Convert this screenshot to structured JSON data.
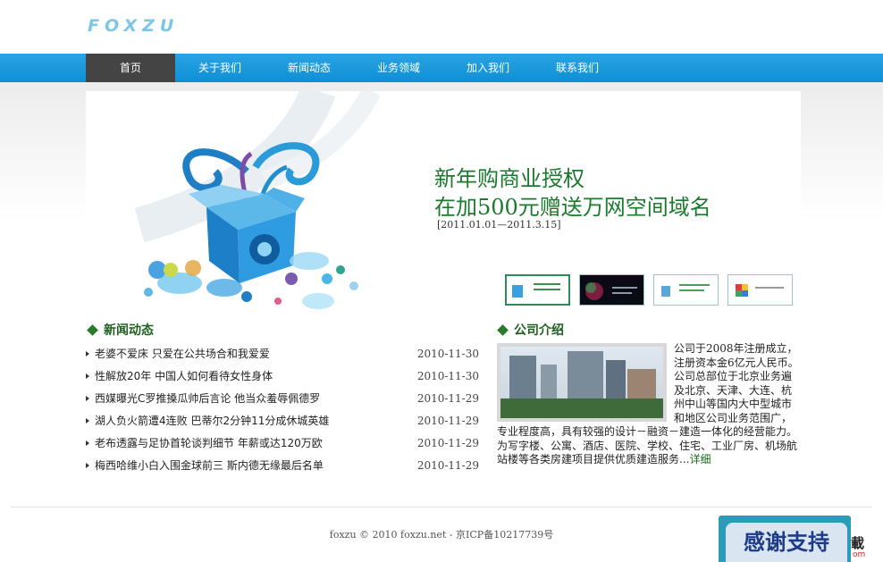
{
  "header": {
    "logo_text": "FOXZU"
  },
  "nav": {
    "items": [
      "首页",
      "关于我们",
      "新闻动态",
      "业务领域",
      "加入我们",
      "联系我们"
    ],
    "active_index": 0
  },
  "banner": {
    "line1": "新年购商业授权",
    "line2": "在加500元赠送万网空间域名",
    "date": "[2011.01.01—2011.3.15]",
    "thumb_count": 4,
    "active_thumb": 0
  },
  "news": {
    "title": "新闻动态",
    "items": [
      {
        "title": "老婆不爱床 只爱在公共场合和我爱爱",
        "date": "2010-11-30"
      },
      {
        "title": "性解放20年 中国人如何看待女性身体",
        "date": "2010-11-30"
      },
      {
        "title": "西媒曝光C罗推搡瓜帅后言论 他当众羞辱佩德罗",
        "date": "2010-11-29"
      },
      {
        "title": "湖人负火箭遭4连败 巴蒂尔2分钟11分成休城英雄",
        "date": "2010-11-29"
      },
      {
        "title": "老布透露与足协首轮谈判细节 年薪或达120万欧",
        "date": "2010-11-29"
      },
      {
        "title": "梅西哈维小白入围金球前三 斯内德无缘最后名单",
        "date": "2010-11-29"
      }
    ]
  },
  "company": {
    "title": "公司介绍",
    "text": "公司于2008年注册成立，注册资本金6亿元人民币。公司总部位于北京业务遍及北京、天津、大连、杭州中山等国内大中型城市和地区公司业务范围广，专业程度高，具有较强的设计－融资－建造一体化的经营能力。为写字楼、公寓、酒店、医院、学校、住宅、工业厂房、机场航站楼等各类房建项目提供优质建造服务...",
    "more": "详细"
  },
  "footer": {
    "text": "foxzu © 2010 foxzu.net - 京ICP备10217739号"
  },
  "overlay": {
    "thanks": "感谢支持",
    "download": "載",
    "download_sub": "om"
  },
  "colors": {
    "nav_blue": "#1a9ae0",
    "nav_active": "#444444",
    "promo_green": "#1b7a2e",
    "section_green": "#1f5f1f"
  }
}
